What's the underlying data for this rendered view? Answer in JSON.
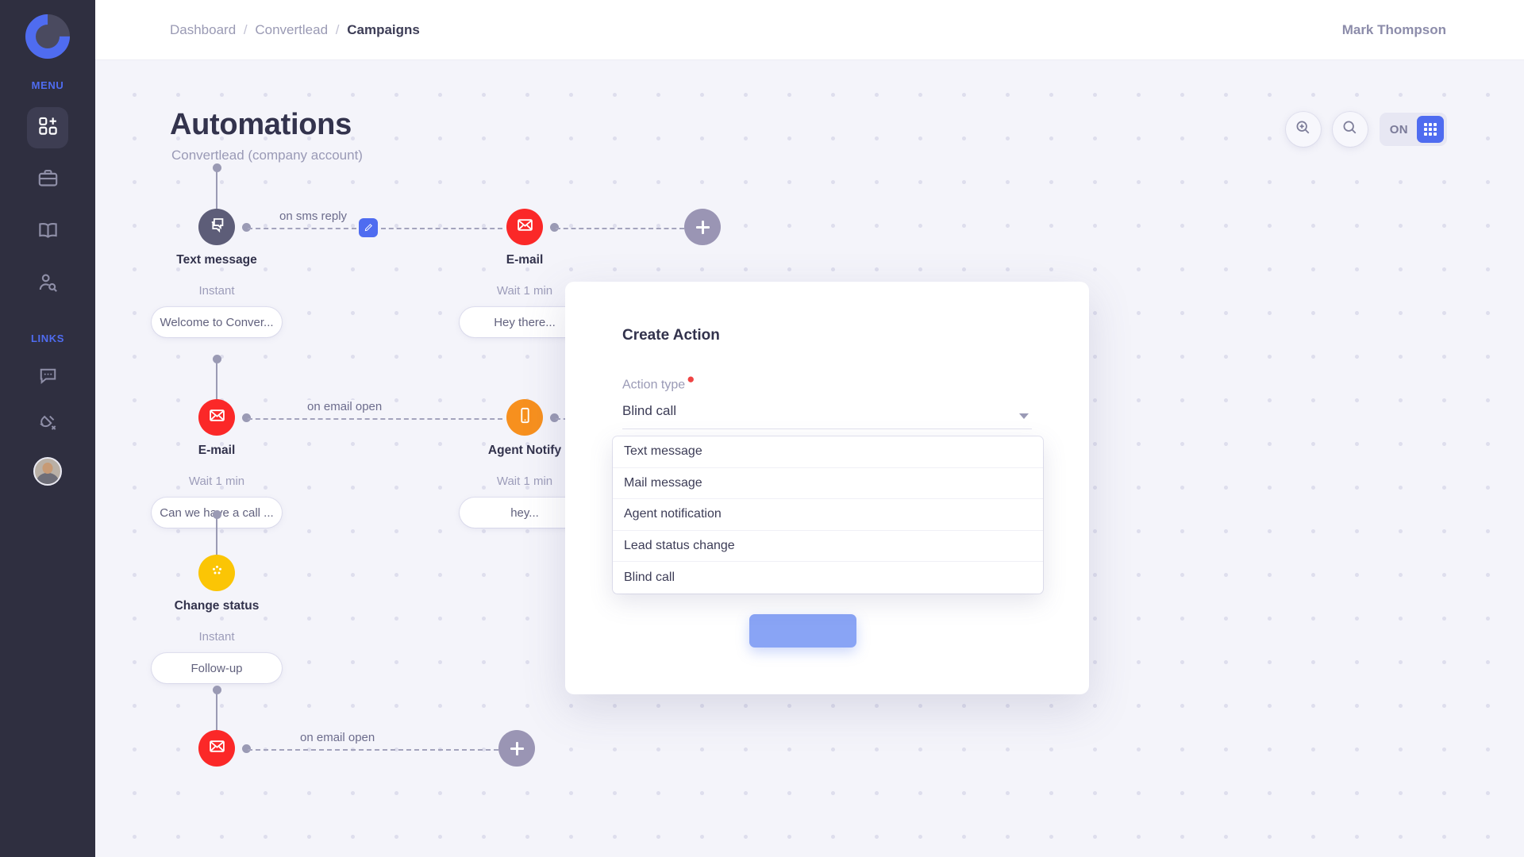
{
  "sidebar": {
    "logo_name": "convertlead-logo",
    "menu_label": "MENU",
    "links_label": "LINKS",
    "menu_items": [
      {
        "name": "dashboard-grid-add-icon",
        "active": true
      },
      {
        "name": "briefcase-icon",
        "active": false
      },
      {
        "name": "book-icon",
        "active": false
      },
      {
        "name": "user-search-icon",
        "active": false
      }
    ],
    "link_items": [
      {
        "name": "chat-bubble-icon"
      },
      {
        "name": "plug-disconnected-icon"
      }
    ],
    "avatar_name": "user-avatar"
  },
  "topbar": {
    "breadcrumb": {
      "root": "Dashboard",
      "middle": "Convertlead",
      "current": "Campaigns",
      "separator": "/"
    },
    "user_name": "Mark Thompson"
  },
  "page": {
    "title": "Automations",
    "subtitle": "Convertlead (company account)"
  },
  "toolbar": {
    "zoom_icon": "zoom-in-icon",
    "search_icon": "search-icon",
    "toggle_state": "ON",
    "grid_icon": "grid-view-icon"
  },
  "flow": {
    "nodes": [
      {
        "id": "text-message",
        "title": "Text message",
        "delay": "Instant",
        "pill": "Welcome to Conver...",
        "color": "#5d5d78",
        "icon": "chat-stack-icon"
      },
      {
        "id": "email-1",
        "title": "E-mail",
        "delay": "Wait 1 min",
        "pill": "Hey there...",
        "color": "#fb2828",
        "icon": "envelope-icon"
      },
      {
        "id": "email-2",
        "title": "E-mail",
        "delay": "Wait 1 min",
        "pill": "Can we have a call ...",
        "color": "#fb2828",
        "icon": "envelope-icon"
      },
      {
        "id": "agent-notify",
        "title": "Agent Notify",
        "delay": "Wait 1 min",
        "pill": "hey...",
        "color": "#f7901e",
        "icon": "mobile-phone-icon"
      },
      {
        "id": "change-status",
        "title": "Change status",
        "delay": "Instant",
        "pill": "Follow-up",
        "color": "#fbc505",
        "icon": "status-dots-icon"
      },
      {
        "id": "email-3",
        "title": "E-mail",
        "delay": "",
        "pill": "",
        "color": "#fb2828",
        "icon": "envelope-icon"
      }
    ],
    "connection_labels": {
      "sms_reply": "on sms reply",
      "email_open_1": "on email open",
      "email_open_2": "on email open"
    },
    "edit_badge_name": "edit-pencil-icon",
    "add_node_label": "+"
  },
  "modal": {
    "title": "Create Action",
    "field_label": "Action type",
    "required_marker": "*",
    "selected_value": "Blind call",
    "options": [
      "Text message",
      "Mail message",
      "Agent notification",
      "Lead status change",
      "Blind call"
    ]
  },
  "colors": {
    "accent": "#4f6cf0",
    "sidebar_bg": "#2f2f40",
    "canvas_bg": "#f4f4fa",
    "danger": "#fb2828",
    "warning": "#f7901e",
    "yellow": "#fbc505"
  }
}
